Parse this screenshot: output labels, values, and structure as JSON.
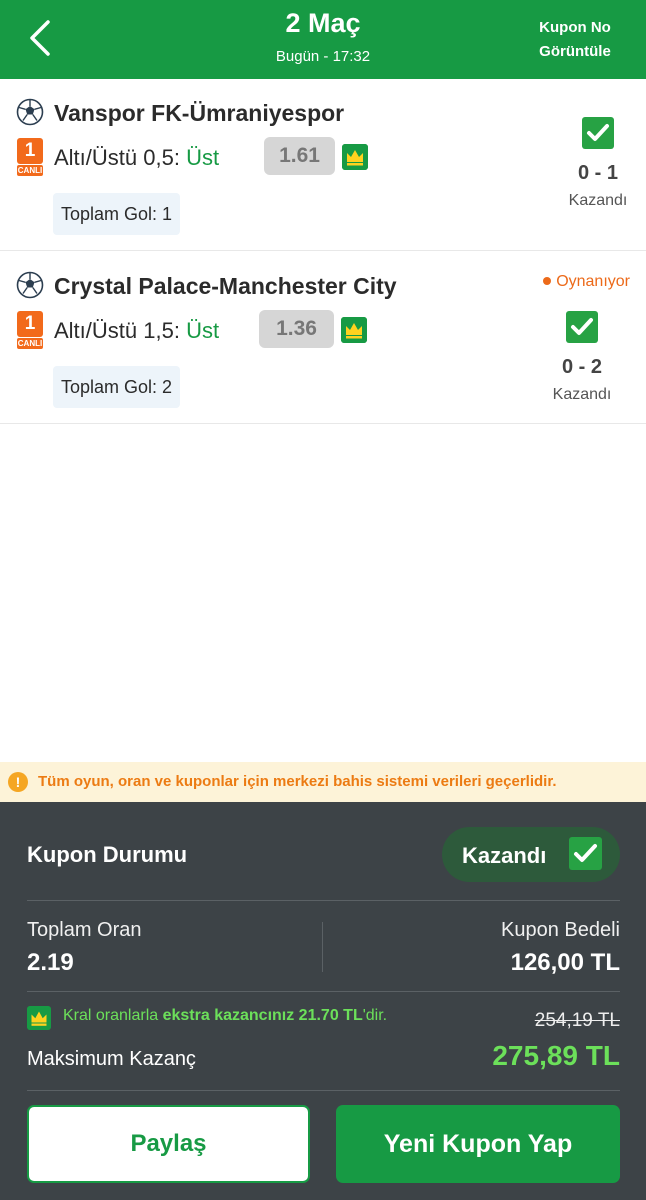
{
  "header": {
    "title": "2 Maç",
    "subtitle": "Bugün - 17:32",
    "right_line1": "Kupon No",
    "right_line2": "Görüntüle"
  },
  "matches": [
    {
      "teams": "Vanspor FK-Ümraniyespor",
      "live_number": "1",
      "live_label": "CANLI",
      "market": "Altı/Üstü 0,5:",
      "pick": "Üst",
      "odd": "1.61",
      "goal_info": "Toplam Gol: 1",
      "score": "0 - 1",
      "result": "Kazandı",
      "status": ""
    },
    {
      "teams": "Crystal Palace-Manchester City",
      "live_number": "1",
      "live_label": "CANLI",
      "market": "Altı/Üstü 1,5:",
      "pick": "Üst",
      "odd": "1.36",
      "goal_info": "Toplam Gol: 2",
      "score": "0 - 2",
      "result": "Kazandı",
      "status": "Oynanıyor"
    }
  ],
  "notice": "Tüm oyun, oran ve kuponlar için merkezi bahis sistemi verileri geçerlidir.",
  "panel": {
    "status_label": "Kupon Durumu",
    "status_value": "Kazandı",
    "total_odds_label": "Toplam Oran",
    "total_odds_value": "2.19",
    "stake_label": "Kupon Bedeli",
    "stake_value": "126,00 TL",
    "promo_prefix": "Kral oranlarla",
    "promo_bold": "ekstra kazancınız 21.70 TL",
    "promo_suffix": "'dir.",
    "old_max": "254,19 TL",
    "max_label": "Maksimum Kazanç",
    "max_value": "275,89 TL"
  },
  "buttons": {
    "share": "Paylaş",
    "new_coupon": "Yeni Kupon Yap"
  },
  "colors": {
    "brand_green": "#179a44",
    "win_green": "#6ce05a",
    "live_orange": "#f26a1b",
    "panel_bg": "#3d4347"
  }
}
